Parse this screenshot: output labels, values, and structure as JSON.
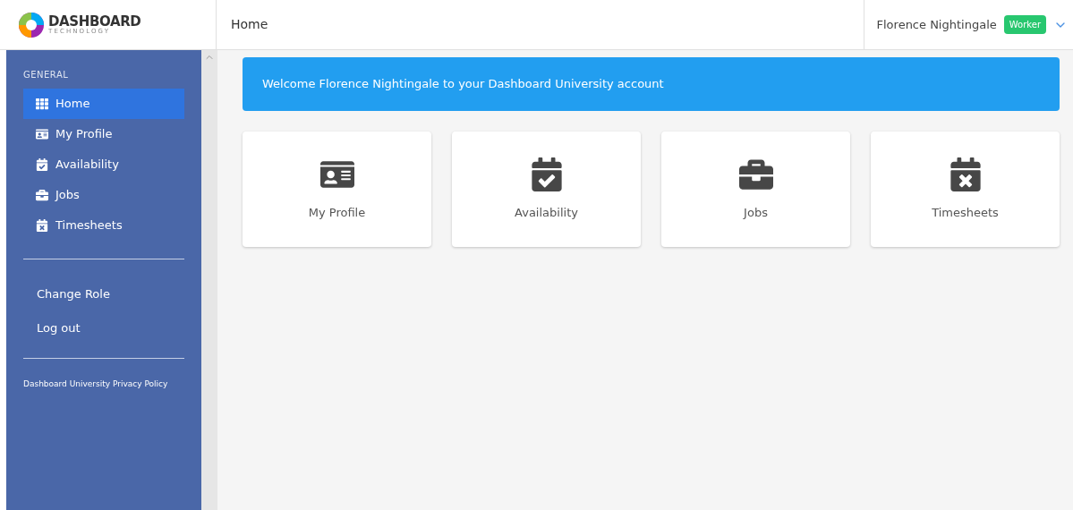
{
  "logo": {
    "name": "DASHBOARD",
    "tagline": "TECHNOLOGY"
  },
  "header": {
    "title": "Home",
    "user": "Florence Nightingale",
    "role": "Worker"
  },
  "sidebar": {
    "section": "GENERAL",
    "items": [
      {
        "label": "Home",
        "kind": "grid",
        "selected": true
      },
      {
        "label": "My Profile",
        "kind": "profile",
        "selected": false
      },
      {
        "label": "Availability",
        "kind": "availability",
        "selected": false
      },
      {
        "label": "Jobs",
        "kind": "jobs",
        "selected": false
      },
      {
        "label": "Timesheets",
        "kind": "timesheets",
        "selected": false
      }
    ],
    "actions": [
      "Change Role",
      "Log out"
    ],
    "footer_link": "Dashboard University Privacy Policy"
  },
  "banner": "Welcome Florence Nightingale to your Dashboard University account",
  "tiles": [
    {
      "label": "My Profile",
      "kind": "profile"
    },
    {
      "label": "Availability",
      "kind": "availability"
    },
    {
      "label": "Jobs",
      "kind": "jobs"
    },
    {
      "label": "Timesheets",
      "kind": "timesheets"
    }
  ]
}
